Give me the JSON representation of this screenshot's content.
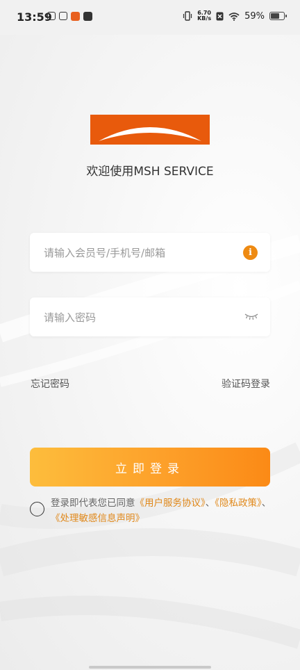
{
  "status_bar": {
    "time": "13:59",
    "net_speed_value": "6.70",
    "net_speed_unit": "KB/s",
    "battery_percent": "59%",
    "battery_level": 0.59
  },
  "brand": {
    "welcome": "欢迎使用MSH SERVICE",
    "logo_color": "#e85a0c"
  },
  "form": {
    "account_placeholder": "请输入会员号/手机号/邮箱",
    "account_value": "",
    "password_placeholder": "请输入密码",
    "password_value": "",
    "info_icon_glyph": "i",
    "forgot_password": "忘记密码",
    "sms_login": "验证码登录",
    "submit_label": "立即登录"
  },
  "agreement": {
    "prefix": "登录即代表您已同意",
    "user_agreement": "《用户服务协议》",
    "separator1": "、",
    "privacy_policy": "《隐私政策》",
    "separator2": "、",
    "sensitive_info": "《处理敏感信息声明》",
    "checked": false
  },
  "colors": {
    "accent": "#ee8a12",
    "link": "#e0881a",
    "button_start": "#fdbd3c",
    "button_end": "#fb8a16"
  }
}
